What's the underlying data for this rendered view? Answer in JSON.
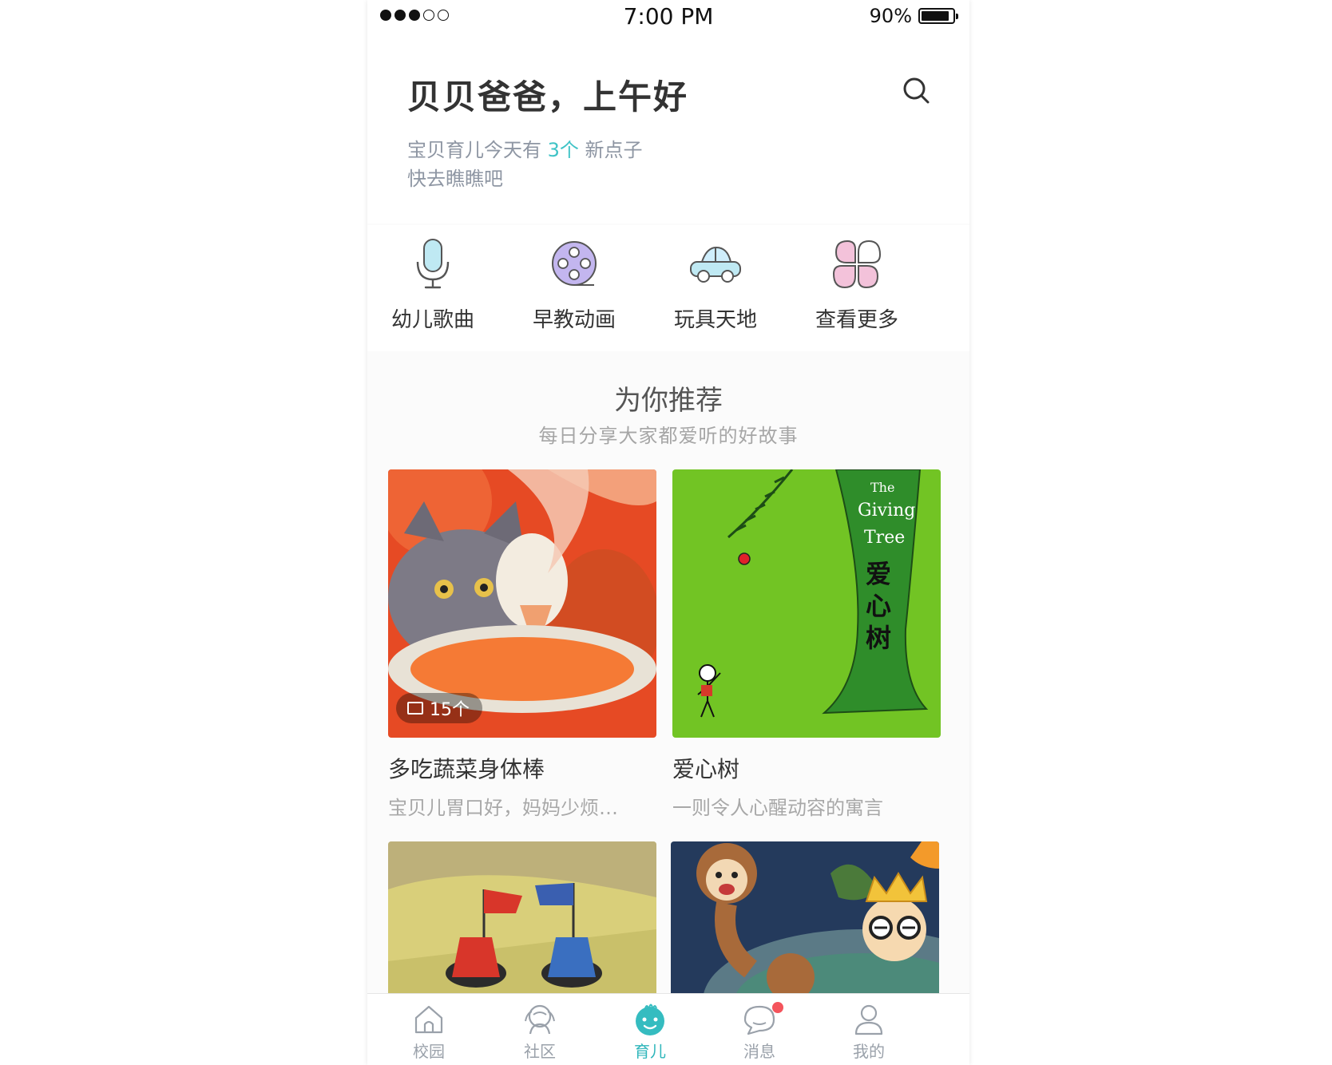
{
  "status_bar": {
    "signal": [
      "full",
      "full",
      "full",
      "empty",
      "empty"
    ],
    "time": "7:00 PM",
    "battery_percent": "90%",
    "battery_level": 0.9
  },
  "header": {
    "greeting": "贝贝爸爸，上午好",
    "subtitle_prefix": "宝贝育儿今天有 ",
    "subtitle_count": "3个",
    "subtitle_suffix": " 新点子",
    "subtitle_line2": "快去瞧瞧吧",
    "search_icon": "search-icon",
    "accent_color": "#3fc3c6"
  },
  "categories": [
    {
      "label": "幼儿歌曲",
      "icon": "microphone-icon"
    },
    {
      "label": "早教动画",
      "icon": "film-reel-icon"
    },
    {
      "label": "玩具天地",
      "icon": "toy-car-icon"
    },
    {
      "label": "查看更多",
      "icon": "more-petals-icon"
    }
  ],
  "recommend": {
    "title": "为你推荐",
    "subtitle": "每日分享大家都爱听的好故事",
    "cards": [
      {
        "title": "多吃蔬菜身体棒",
        "desc": "宝贝儿胃口好，妈妈少烦…",
        "badge": "15个"
      },
      {
        "title": "爱心树",
        "desc": "一则令人心醒动容的寓言",
        "cover_text": [
          "The",
          "Giving",
          "Tree",
          "爱",
          "心",
          "树"
        ]
      },
      {
        "title": "",
        "desc": ""
      },
      {
        "title": "",
        "desc": ""
      }
    ]
  },
  "tabs": [
    {
      "label": "校园",
      "icon": "school-icon",
      "active": false
    },
    {
      "label": "社区",
      "icon": "community-icon",
      "active": false
    },
    {
      "label": "育儿",
      "icon": "baby-icon",
      "active": true
    },
    {
      "label": "消息",
      "icon": "message-icon",
      "active": false,
      "unread": true
    },
    {
      "label": "我的",
      "icon": "profile-icon",
      "active": false
    }
  ]
}
